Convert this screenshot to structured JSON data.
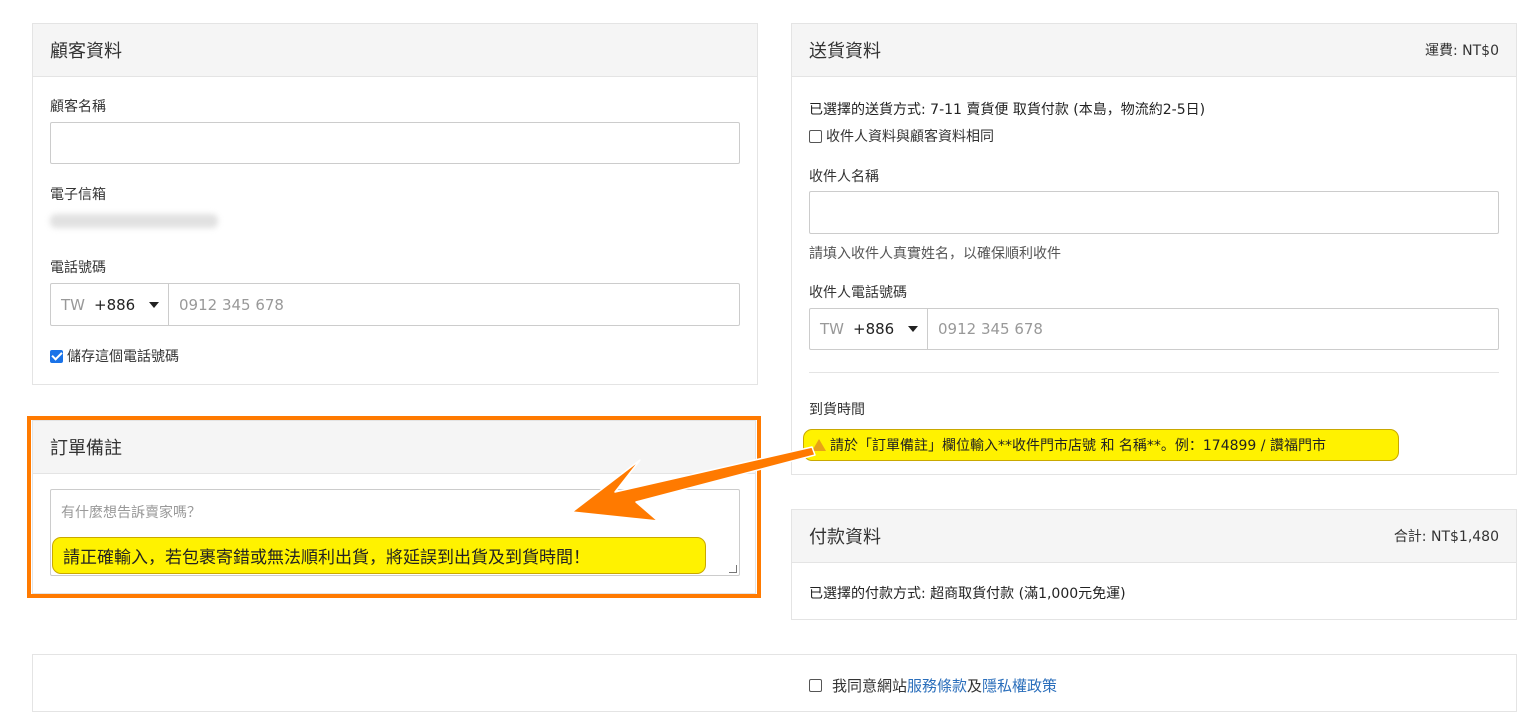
{
  "customer": {
    "title": "顧客資料",
    "name_label": "顧客名稱",
    "email_label": "電子信箱",
    "phone_label": "電話號碼",
    "phone_iso": "TW",
    "phone_dial": "+886",
    "phone_placeholder": "0912 345 678",
    "save_phone_label": "儲存這個電話號碼"
  },
  "notes": {
    "title": "訂單備註",
    "placeholder": "有什麼想告訴賣家嗎？",
    "warning": "請正確輸入，若包裹寄錯或無法順利出貨，將延誤到出貨及到貨時間！"
  },
  "shipping": {
    "title": "送貨資料",
    "fee": "運費: NT$0",
    "method_text": "已選擇的送貨方式: 7-11 賣貨便 取貨付款 (本島，物流約2-5日)",
    "same_as_customer_label": "收件人資料與顧客資料相同",
    "recipient_name_label": "收件人名稱",
    "recipient_name_hint": "請填入收件人真實姓名，以確保順利收件",
    "recipient_phone_label": "收件人電話號碼",
    "phone_iso": "TW",
    "phone_dial": "+886",
    "phone_placeholder": "0912 345 678",
    "arrival_label": "到貨時間",
    "arrival_notice": "請於「訂單備註」欄位輸入**收件門市店號 和 名稱**。例：174899 / 讚福門市"
  },
  "payment": {
    "title": "付款資料",
    "total": "合計: NT$1,480",
    "method_text": "已選擇的付款方式: 超商取貨付款 (滿1,000元免運)"
  },
  "agreement": {
    "prefix": "我同意網站",
    "terms_link": "服務條款",
    "and": "及",
    "privacy_link": "隱私權政策"
  },
  "colors": {
    "highlight_border": "#ff7a00",
    "arrow": "#ff7a00",
    "callout_bg": "#fff200",
    "link": "#2a6ebb"
  }
}
